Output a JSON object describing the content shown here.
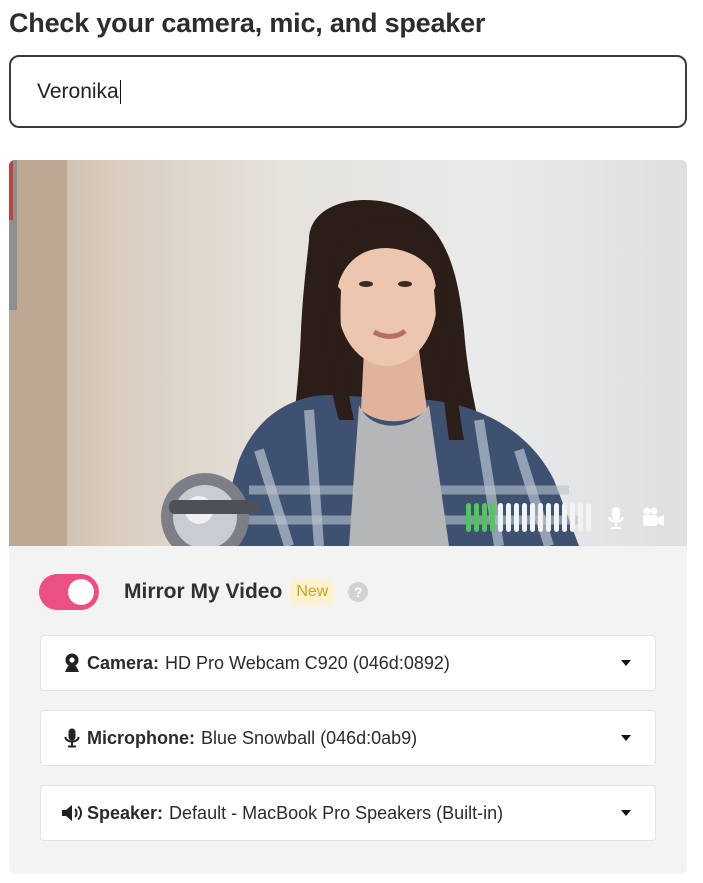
{
  "title": "Check your camera, mic, and speaker",
  "name_input": {
    "value": "Veronika"
  },
  "video": {
    "audio_level": {
      "active_bars": 4,
      "total_bars": 16
    },
    "colors": {
      "meter_active": "#4fc857",
      "meter_inactive": "#f2f2f2"
    },
    "icons": [
      "microphone-icon",
      "video-camera-icon"
    ]
  },
  "mirror": {
    "label": "Mirror My Video",
    "badge": "New",
    "enabled": true,
    "toggle_color": "#ec4f82"
  },
  "devices": [
    {
      "icon": "webcam-icon",
      "label": "Camera:",
      "value": "HD Pro Webcam C920 (046d:0892)"
    },
    {
      "icon": "microphone-icon",
      "label": "Microphone:",
      "value": "Blue Snowball (046d:0ab9)"
    },
    {
      "icon": "speaker-icon",
      "label": "Speaker:",
      "value": "Default - MacBook Pro Speakers (Built-in)"
    }
  ]
}
